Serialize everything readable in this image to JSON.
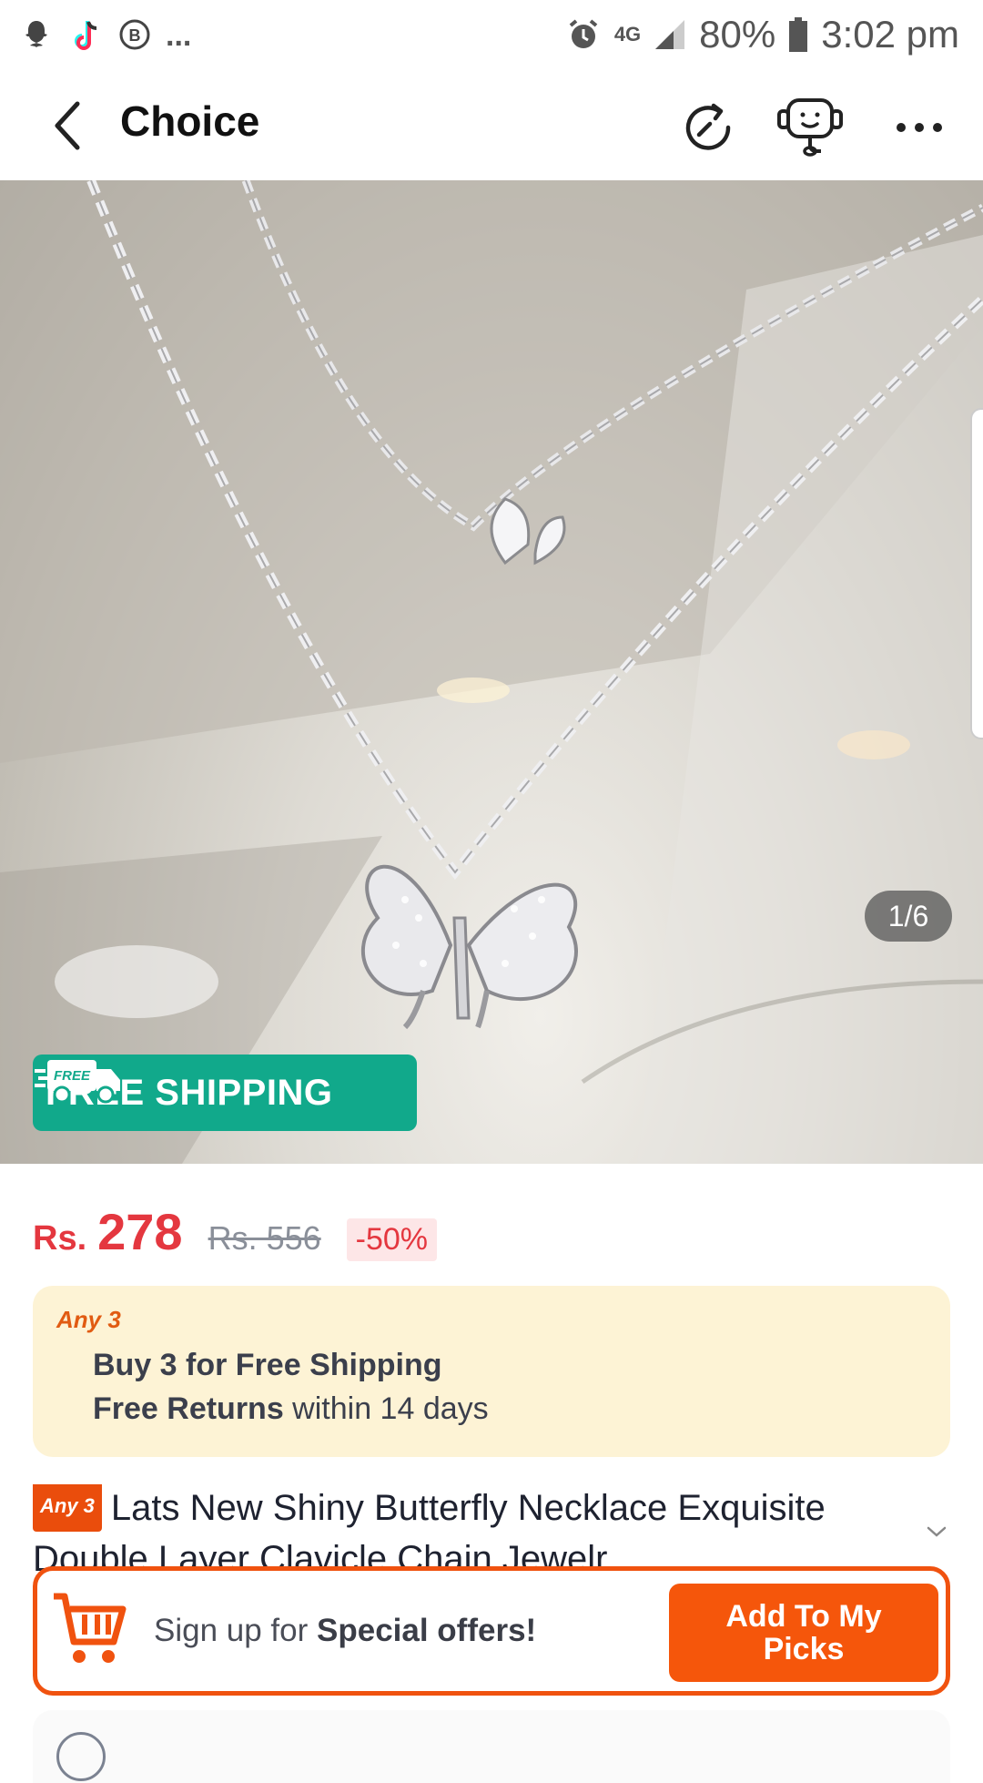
{
  "status_bar": {
    "more": "...",
    "network": "4G",
    "battery": "80%",
    "time": "3:02 pm"
  },
  "app_bar": {
    "title": "Choice"
  },
  "gallery": {
    "badge_label": "FREE SHIPPING",
    "badge_icon_text": "FREE",
    "counter": "1/6",
    "badge_color": "#11a98b"
  },
  "price": {
    "currency": "Rs.",
    "current": "278",
    "original": "Rs. 556",
    "discount": "-50%",
    "accent": "#e4373f"
  },
  "promo": {
    "tag": "Any 3",
    "line1": "Buy 3 for  Free Shipping",
    "line2_bold": "Free Returns",
    "line2_rest": " within 14 days"
  },
  "product": {
    "badge": "Any 3",
    "title": "Lats New Shiny Butterfly Necklace Exquisite Double Layer Clavicle Chain Jewelr..."
  },
  "signup_bar": {
    "text_pre": "Sign up for ",
    "text_bold": "Special offers!",
    "button": "Add To My Picks",
    "accent": "#f5560b"
  }
}
